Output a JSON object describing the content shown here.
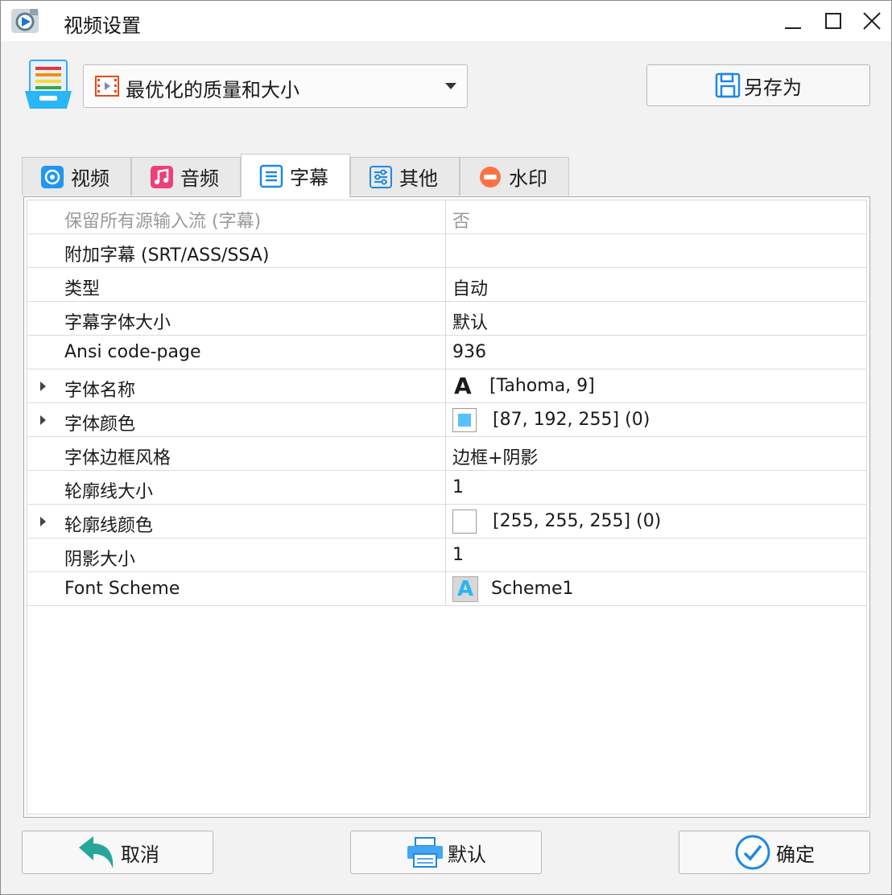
{
  "window": {
    "title": "视频设置"
  },
  "toolbar": {
    "preset_value": "最优化的质量和大小",
    "save_as_label": "另存为"
  },
  "tabs": [
    {
      "label": "视频",
      "icon": "video-icon",
      "active": false
    },
    {
      "label": "音频",
      "icon": "music-icon",
      "active": false
    },
    {
      "label": "字幕",
      "icon": "subtitle-icon",
      "active": true
    },
    {
      "label": "其他",
      "icon": "sliders-icon",
      "active": false
    },
    {
      "label": "水印",
      "icon": "watermark-icon",
      "active": false
    }
  ],
  "properties": [
    {
      "name": "保留所有源输入流 (字幕)",
      "value": "否"
    },
    {
      "name": "附加字幕 (SRT/ASS/SSA)",
      "value": ""
    },
    {
      "name": "类型",
      "value": "自动"
    },
    {
      "name": "字幕字体大小",
      "value": "默认"
    },
    {
      "name": "Ansi code-page",
      "value": "936"
    },
    {
      "name": "字体名称",
      "value": "[Tahoma, 9]",
      "glyph": "A"
    },
    {
      "name": "字体颜色",
      "value": "[87, 192, 255] (0)",
      "color": "#57c0ff"
    },
    {
      "name": "字体边框风格",
      "value": "边框+阴影"
    },
    {
      "name": "轮廓线大小",
      "value": "1"
    },
    {
      "name": "轮廓线颜色",
      "value": "[255, 255, 255] (0)",
      "color": "#ffffff"
    },
    {
      "name": "阴影大小",
      "value": "1"
    },
    {
      "name": "Font Scheme",
      "value": "Scheme1",
      "glyph": "A"
    }
  ],
  "footer": {
    "cancel_label": "取消",
    "default_label": "默认",
    "ok_label": "确定"
  },
  "colors": {
    "accent": "#1e88e5",
    "tab_active_bg": "#ffffff",
    "window_bg": "#f2f2f2"
  }
}
